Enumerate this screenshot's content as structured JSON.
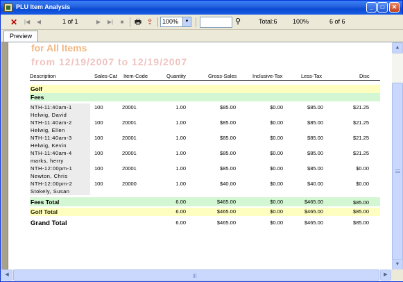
{
  "window": {
    "title": "PLU Item Analysis",
    "min_glyph": "_",
    "max_glyph": "□",
    "close_glyph": "✕"
  },
  "toolbar": {
    "close_glyph": "✕",
    "first_glyph": "|◀",
    "prev_glyph": "◀",
    "page_of": "1 of 1",
    "next_glyph": "▶",
    "last_glyph": "▶|",
    "stop_glyph": "■",
    "print_glyph": "🖶",
    "export_glyph": "⇪",
    "zoom": "100%",
    "zoom_arrow": "▼",
    "search_value": "",
    "find_glyph": "⚲",
    "total": "Total:6",
    "percent": "100%",
    "count": "6 of 6"
  },
  "tabs": {
    "preview": "Preview"
  },
  "scroll": {
    "up": "▲",
    "down": "▼",
    "left": "◀",
    "right": "▶"
  },
  "report": {
    "title_line1": "for All Items",
    "title_line2": "from 12/19/2007 to 12/19/2007",
    "columns": {
      "description": "Description",
      "sales_cat": "Sales-Cat",
      "item_code": "Item-Code",
      "quantity": "Quantity",
      "gross_sales": "Gross-Sales",
      "inclusive_tax": "Inclusive-Tax",
      "less_tax": "Less-Tax",
      "disc": "Disc"
    },
    "group1": "Golf",
    "group2": "Fees",
    "rows": [
      {
        "line1": "NTH-11:40am-1",
        "line2": "Helwig, David",
        "cat": "100",
        "code": "20001",
        "qty": "1.00",
        "gross": "$85.00",
        "inc_tax": "$0.00",
        "less_tax": "$85.00",
        "disc": "$21.25"
      },
      {
        "line1": "NTH-11:40am-2",
        "line2": "Helwig, Ellen",
        "cat": "100",
        "code": "20001",
        "qty": "1.00",
        "gross": "$85.00",
        "inc_tax": "$0.00",
        "less_tax": "$85.00",
        "disc": "$21.25"
      },
      {
        "line1": "NTH-11:40am-3",
        "line2": "Helwig, Kevin",
        "cat": "100",
        "code": "20001",
        "qty": "1.00",
        "gross": "$85.00",
        "inc_tax": "$0.00",
        "less_tax": "$85.00",
        "disc": "$21.25"
      },
      {
        "line1": "NTH-11:40am-4",
        "line2": "marks, herry",
        "cat": "100",
        "code": "20001",
        "qty": "1.00",
        "gross": "$85.00",
        "inc_tax": "$0.00",
        "less_tax": "$85.00",
        "disc": "$21.25"
      },
      {
        "line1": "NTH-12:00pm-1",
        "line2": "Newton, Chris",
        "cat": "100",
        "code": "20001",
        "qty": "1.00",
        "gross": "$85.00",
        "inc_tax": "$0.00",
        "less_tax": "$85.00",
        "disc": "$0.00"
      },
      {
        "line1": "NTH-12:00pm-2",
        "line2": "Stokely, Susan",
        "cat": "100",
        "code": "20000",
        "qty": "1.00",
        "gross": "$40.00",
        "inc_tax": "$0.00",
        "less_tax": "$40.00",
        "disc": "$0.00"
      }
    ],
    "fees_total": {
      "label": "Fees Total",
      "qty": "6.00",
      "gross": "$465.00",
      "inc_tax": "$0.00",
      "less_tax": "$465.00",
      "disc": "$85.00"
    },
    "golf_total": {
      "label": "Golf Total",
      "qty": "6.00",
      "gross": "$465.00",
      "inc_tax": "$0.00",
      "less_tax": "$465.00",
      "disc": "$85.00"
    },
    "grand_total": {
      "label": "Grand Total",
      "qty": "6.00",
      "gross": "$465.00",
      "inc_tax": "$0.00",
      "less_tax": "$465.00",
      "disc": "$85.00"
    }
  },
  "colors": {
    "title1": "#f2b682",
    "title2": "#efc2be",
    "band_yellow": "#fefec0",
    "band_green": "#d3f6d3"
  }
}
